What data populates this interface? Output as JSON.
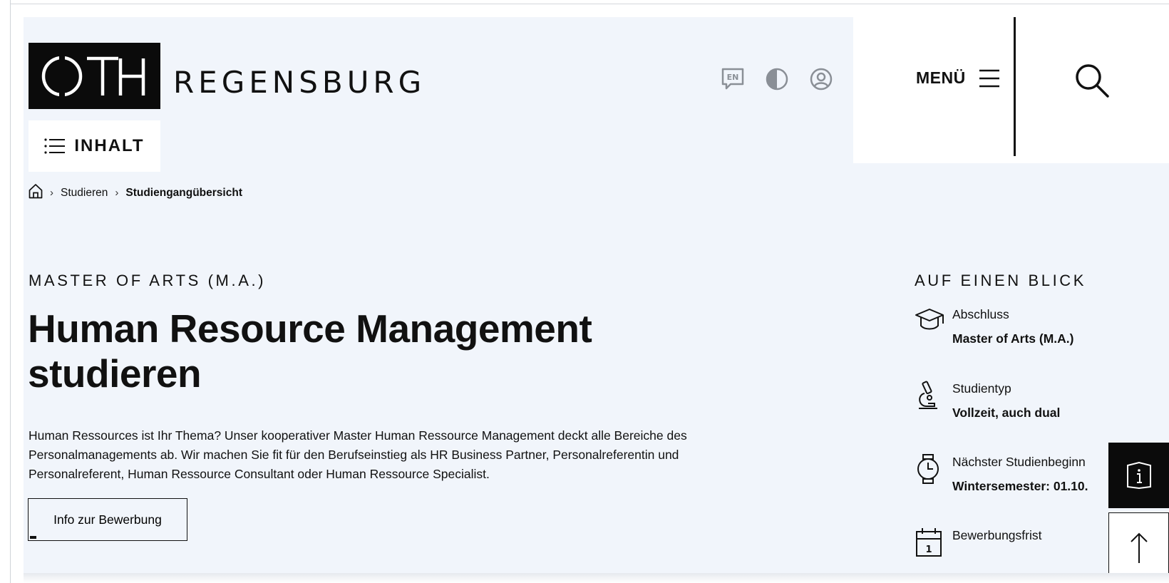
{
  "header": {
    "logo_text": "OTH",
    "logo_word": "REGENSBURG",
    "inhalt_label": "INHALT",
    "icons": [
      "language-en-icon",
      "contrast-icon",
      "user-icon"
    ],
    "language_badge": "EN",
    "menu_label": "MENÜ"
  },
  "breadcrumb": {
    "items": [
      "Studieren",
      "Studiengangübersicht"
    ]
  },
  "main": {
    "kicker": "MASTER OF ARTS (M.A.)",
    "title_line1": "Human Resource Management",
    "title_line2": "studieren",
    "lead": "Human Ressources ist Ihr Thema? Unser kooperativer Master Human Ressource Management deckt alle Bereiche des Personalmanagements ab. Wir machen Sie fit für den Berufseinstieg als HR Business Partner, Personalreferentin und Personalreferent, Human Ressource Consultant oder Human Ressource Specialist.",
    "cta_label": "Info zur Bewerbung"
  },
  "glance": {
    "title": "AUF EINEN BLICK",
    "items": [
      {
        "icon": "graduation-cap-icon",
        "label": "Abschluss",
        "value": "Master of Arts (M.A.)"
      },
      {
        "icon": "microscope-icon",
        "label": "Studientyp",
        "value": "Vollzeit, auch dual"
      },
      {
        "icon": "watch-icon",
        "label": "Nächster Studienbeginn",
        "value": "Wintersemester: 01.10."
      },
      {
        "icon": "calendar-icon",
        "label": "Bewerbungsfrist",
        "value": ""
      }
    ],
    "calendar_day": "1"
  }
}
